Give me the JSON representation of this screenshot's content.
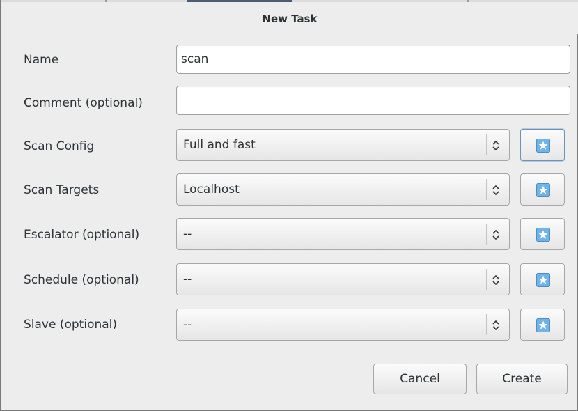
{
  "window": {
    "title": "New Task"
  },
  "form": {
    "name": {
      "label": "Name",
      "value": "scan"
    },
    "comment": {
      "label": "Comment (optional)",
      "value": ""
    },
    "scan_config": {
      "label": "Scan Config",
      "value": "Full and fast",
      "new_button_icon": "star-icon"
    },
    "scan_targets": {
      "label": "Scan Targets",
      "value": "Localhost",
      "new_button_icon": "star-icon"
    },
    "escalator": {
      "label": "Escalator (optional)",
      "value": "--",
      "new_button_icon": "star-icon"
    },
    "schedule": {
      "label": "Schedule (optional)",
      "value": "--",
      "new_button_icon": "star-icon"
    },
    "slave": {
      "label": "Slave (optional)",
      "value": "--",
      "new_button_icon": "star-icon"
    }
  },
  "actions": {
    "cancel_label": "Cancel",
    "create_label": "Create"
  },
  "colors": {
    "background": "#ededed",
    "star_icon_blue": "#6fb3e8",
    "focus_border": "#6e93b6"
  }
}
